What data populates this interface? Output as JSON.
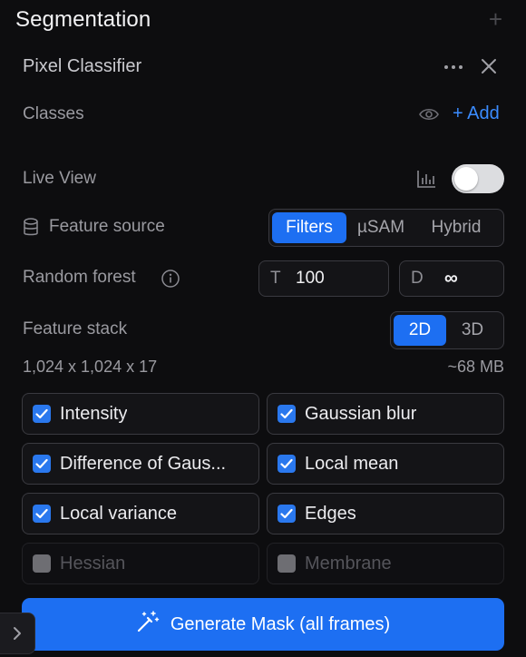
{
  "panel": {
    "title": "Segmentation"
  },
  "classifier": {
    "name": "Pixel Classifier"
  },
  "classes": {
    "label": "Classes",
    "add_label": "+ Add"
  },
  "live_view": {
    "label": "Live View",
    "enabled": false
  },
  "feature_source": {
    "label": "Feature source",
    "options": [
      "Filters",
      "µSAM",
      "Hybrid"
    ],
    "selected": "Filters"
  },
  "random_forest": {
    "label": "Random forest",
    "t_prefix": "T",
    "t_value": "100",
    "d_prefix": "D",
    "d_value": "∞"
  },
  "feature_stack": {
    "label": "Feature stack",
    "options": [
      "2D",
      "3D"
    ],
    "selected": "2D",
    "dims": "1,024 x 1,024 x 17",
    "size": "~68 MB"
  },
  "features": [
    {
      "label": "Intensity",
      "checked": true,
      "enabled": true
    },
    {
      "label": "Gaussian blur",
      "checked": true,
      "enabled": true
    },
    {
      "label": "Difference of Gaus...",
      "checked": true,
      "enabled": true
    },
    {
      "label": "Local mean",
      "checked": true,
      "enabled": true
    },
    {
      "label": "Local variance",
      "checked": true,
      "enabled": true
    },
    {
      "label": "Edges",
      "checked": true,
      "enabled": true
    },
    {
      "label": "Hessian",
      "checked": false,
      "enabled": false
    },
    {
      "label": "Membrane",
      "checked": false,
      "enabled": false
    }
  ],
  "generate": {
    "label": "Generate Mask (all frames)"
  },
  "colors": {
    "accent": "#1d6ff2",
    "link": "#3b8cff",
    "background": "#0d0d0f"
  }
}
